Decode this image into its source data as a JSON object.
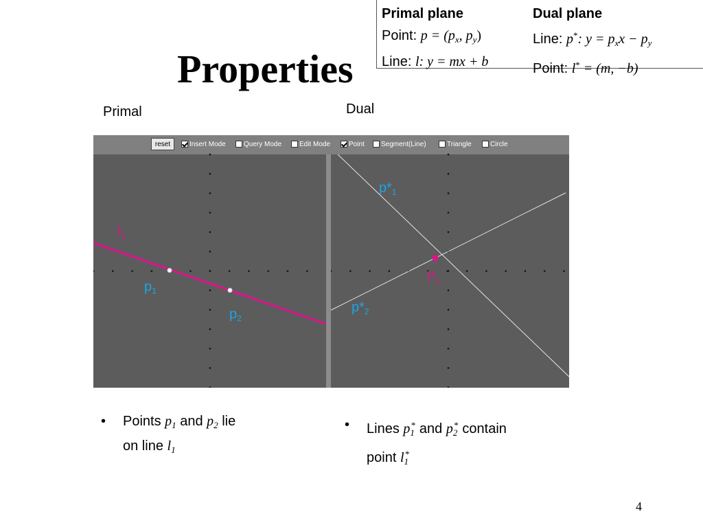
{
  "slide": {
    "title": "Properties",
    "page_number": "4",
    "primal_label": "Primal",
    "dual_label": "Dual"
  },
  "definitions": {
    "primal": {
      "heading": "Primal plane",
      "point_prefix": "Point: ",
      "point_math": "p = (p",
      "point_sub1": "x",
      "point_mid": ", p",
      "point_sub2": "y",
      "point_end": ")",
      "line_prefix": "Line: ",
      "line_math": "l: y = mx + b"
    },
    "dual": {
      "heading": "Dual plane",
      "line_prefix": "Line: ",
      "line_p": "p",
      "line_star": "*",
      "line_math": ": y = p",
      "line_sub1": "x",
      "line_mid": "x − p",
      "line_sub2": "y",
      "point_prefix": "Point: ",
      "point_l": "l",
      "point_star": "*",
      "point_math": " = (m, −b)"
    }
  },
  "toolbar": {
    "reset_label": "reset",
    "items": [
      {
        "label": "Insert Mode",
        "checked": true
      },
      {
        "label": "Query Mode",
        "checked": false
      },
      {
        "label": "Edit Mode",
        "checked": false
      },
      {
        "label": "Point",
        "checked": true
      },
      {
        "label": "Segment(Line)",
        "checked": false
      },
      {
        "label": "Triangle",
        "checked": false
      },
      {
        "label": "Circle",
        "checked": false
      }
    ]
  },
  "canvas_labels": {
    "l1": {
      "base": "l",
      "sub": "1"
    },
    "p1": {
      "base": "p",
      "sub": "1"
    },
    "p2": {
      "base": "p",
      "sub": "2"
    },
    "p1_star": {
      "base": "p*",
      "sub": "1"
    },
    "p2_star": {
      "base": "p*",
      "sub": "2"
    },
    "l1_star": {
      "base": "l*",
      "sub": "1"
    }
  },
  "colors": {
    "magenta": "#e0138c",
    "blue": "#1aa6e6",
    "canvas_bg": "#5c5c5c"
  },
  "bullets": {
    "left": {
      "t1": "Points ",
      "p": "p",
      "s1": "1",
      "and": " and ",
      "p2": "p",
      "s2": "2",
      "t2": " lie",
      "t3": "on line ",
      "l": "l",
      "s3": "1"
    },
    "right": {
      "t1": "Lines ",
      "p": "p",
      "s1": "1",
      "star1": "*",
      "and": " and ",
      "p2": "p",
      "s2": "2",
      "star2": "*",
      "t2": " contain",
      "t3": "point ",
      "l": "l",
      "s3": "1",
      "star3": "*"
    }
  }
}
